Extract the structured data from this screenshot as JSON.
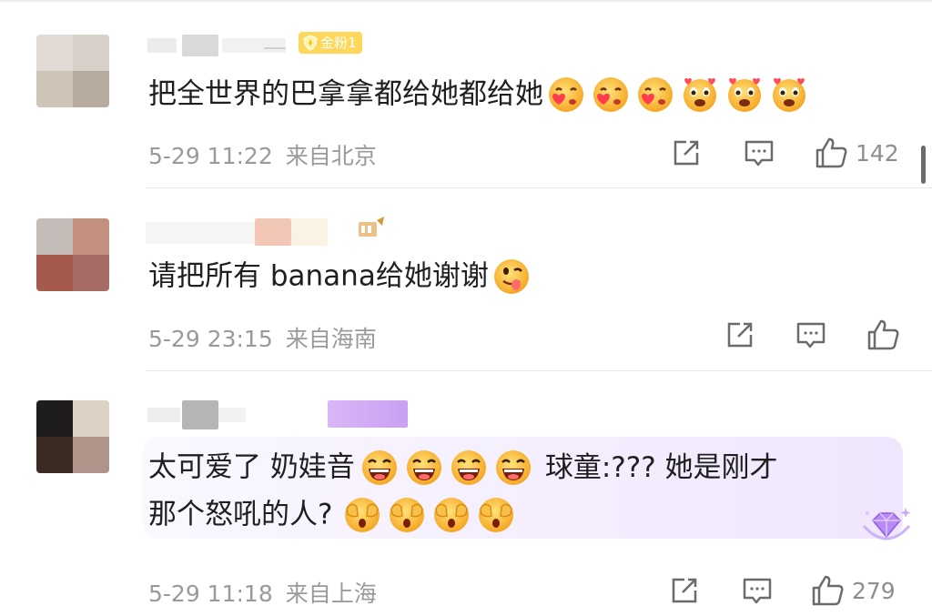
{
  "comments": [
    {
      "badge_label": "金粉1",
      "text": "把全世界的巴拿拿都给她都给她",
      "date": "5-29 11:22",
      "location": "来自北京",
      "likes": "142",
      "emojis": [
        "kiss-heart-face-icon",
        "kiss-heart-face-icon",
        "kiss-heart-face-icon",
        "heart-eyes-face-icon",
        "heart-eyes-face-icon",
        "heart-eyes-face-icon"
      ],
      "avatar_colors": [
        "#e2dbd5",
        "#d8d1ca",
        "#cfc4b8",
        "#b7aa9f"
      ]
    },
    {
      "text": "请把所有 banana给她谢谢",
      "date": "5-29 23:15",
      "location": "来自海南",
      "likes": "",
      "emojis": [
        "tongue-face-icon"
      ],
      "avatar_colors": [
        "#c4bcb9",
        "#c2907c",
        "#a65a4e",
        "#a76c66"
      ]
    },
    {
      "text_line1": "太可爱了 奶娃音",
      "text_line1_tail": "球童:??? 她是刚才",
      "text_line2": "那个怒吼的人?",
      "date": "5-29 11:18",
      "location": "来自上海",
      "likes": "279",
      "emojis_line1": [
        "laughing-face-icon",
        "laughing-face-icon",
        "laughing-face-icon",
        "laughing-face-icon"
      ],
      "emojis_line2": [
        "cover-face-icon",
        "cover-face-icon",
        "cover-face-icon",
        "cover-face-icon"
      ],
      "avatar_colors": [
        "#1e1c1c",
        "#ddd2c3",
        "#3b2a22",
        "#b0948a"
      ]
    }
  ],
  "colors": {
    "meta_text": "#9a9a9a",
    "badge_gold": "#ffd75a",
    "highlight_purple": "#efe6fd"
  }
}
